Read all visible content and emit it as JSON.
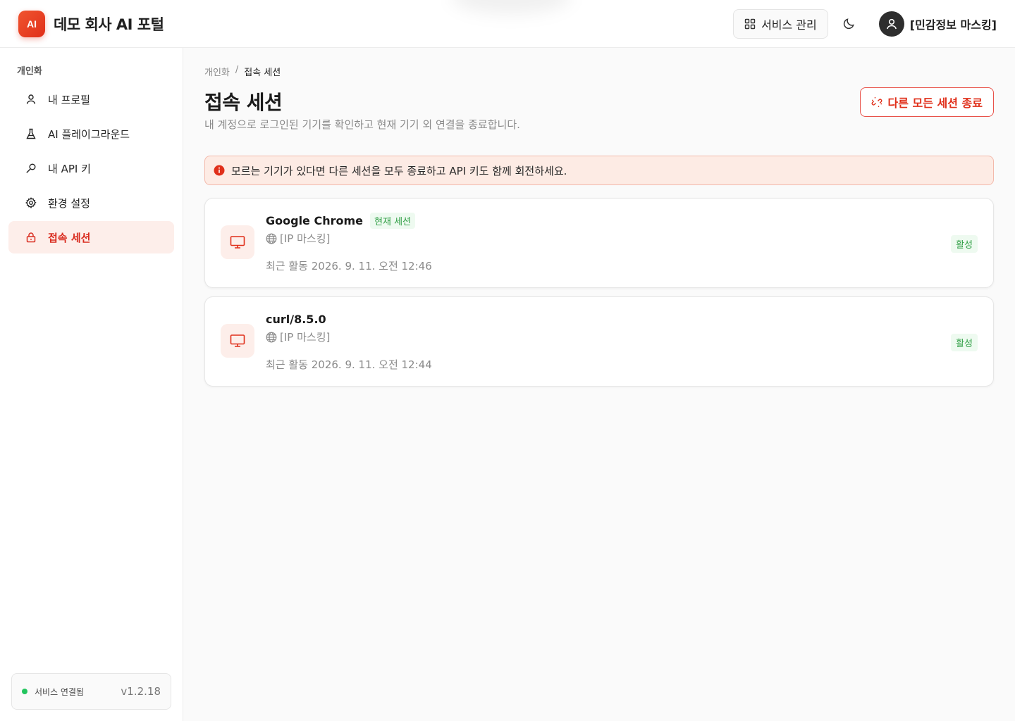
{
  "header": {
    "logo_text": "AI",
    "app_title": "데모 회사 AI 포털",
    "service_button_label": "서비스 관리",
    "user_name": "[민감정보 마스킹]"
  },
  "sidebar": {
    "section_label": "개인화",
    "items": [
      {
        "label": "내 프로필",
        "icon": "user-icon"
      },
      {
        "label": "AI 플레이그라운드",
        "icon": "flask-icon"
      },
      {
        "label": "내 API 키",
        "icon": "key-icon"
      },
      {
        "label": "환경 설정",
        "icon": "gear-icon"
      },
      {
        "label": "접속 세션",
        "icon": "lock-icon",
        "active": true
      }
    ],
    "status_text": "서비스 연결됨",
    "version": "v1.2.18"
  },
  "main": {
    "breadcrumb": [
      "개인화",
      "/",
      "접속 세션"
    ],
    "title": "접속 세션",
    "description": "내 계정으로 로그인된 기기를 확인하고 현재 기기 외 연결을 종료합니다.",
    "end_all_button": "다른 모든 세션 종료",
    "alert": "모르는 기기가 있다면 다른 세션을 모두 종료하고 API 키도 함께 회전하세요.",
    "sessions": [
      {
        "device": "Google Chrome",
        "current_badge": "현재 세션",
        "ip": "[IP 마스킹]",
        "last_active": "최근 활동 2026. 9. 11. 오전 12:46",
        "status": "활성"
      },
      {
        "device": "curl/8.5.0",
        "ip": "[IP 마스킹]",
        "last_active": "최근 활동 2026. 9. 11. 오전 12:44",
        "status": "활성"
      }
    ]
  },
  "colors": {
    "accent": "#e02f1a",
    "active_nav_bg": "#fdeeea",
    "success": "#2f9e44",
    "status_dot": "#22c55e"
  }
}
